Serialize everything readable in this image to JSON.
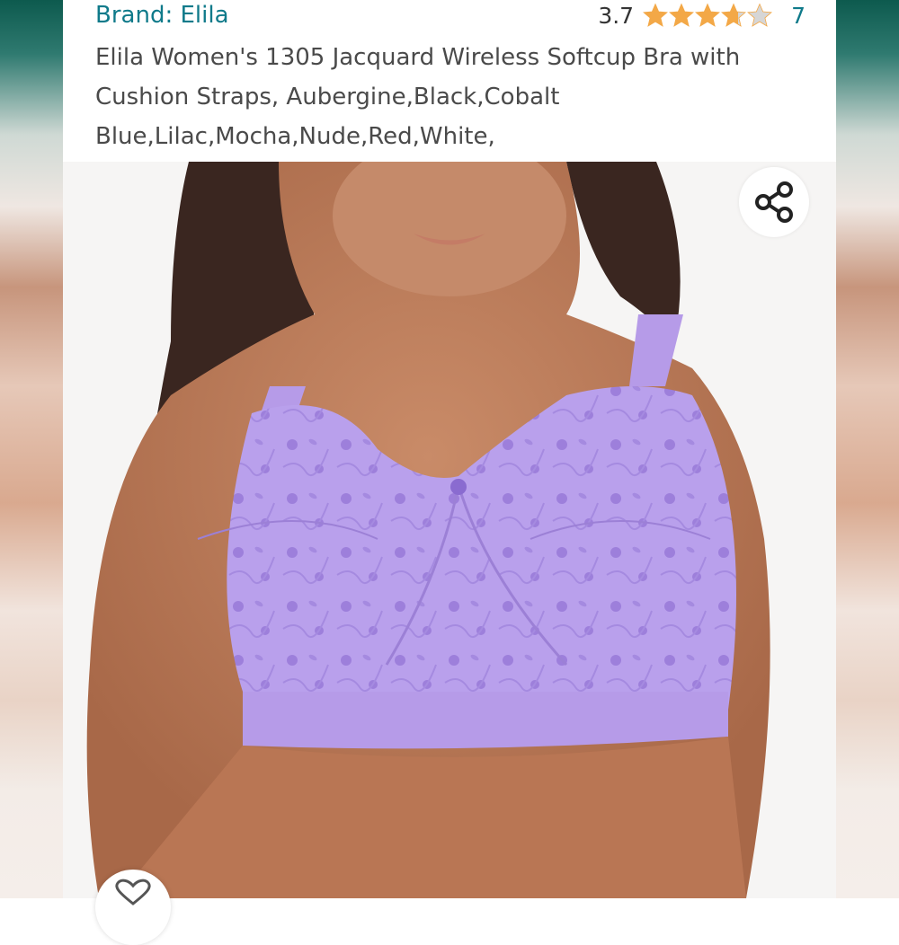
{
  "header": {
    "brand": "Brand: Elila",
    "rating_value": "3.7",
    "rating": 3.7,
    "rating_max": 5,
    "rating_count": "7",
    "title_lines": [
      "Elila Women's 1305 Jacquard Wireless Softcup Bra with",
      "Cushion Straps, Aubergine,Black,Cobalt",
      "Blue,Lilac,Mocha,Nude,Red,White,"
    ]
  },
  "colors": {
    "link": "#0f7a8a",
    "star_filled": "#f3a847",
    "star_empty": "#d6d6d6",
    "product_lilac": "#b69be8"
  },
  "icons": {
    "share": "share-icon",
    "wishlist": "heart-icon"
  }
}
